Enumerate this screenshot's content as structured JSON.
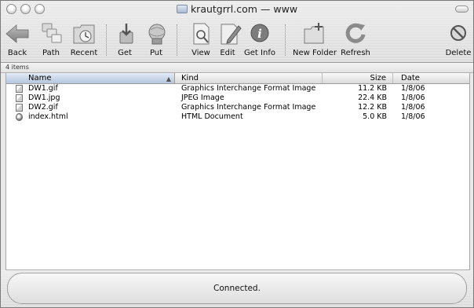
{
  "window": {
    "title": "krautgrrl.com — www"
  },
  "toolbar": {
    "items": [
      {
        "label": "Back",
        "icon": "back-arrow-icon"
      },
      {
        "label": "Path",
        "icon": "path-icon"
      },
      {
        "label": "Recent",
        "icon": "recent-icon"
      },
      {
        "label": "Get",
        "icon": "get-icon"
      },
      {
        "label": "Put",
        "icon": "put-icon"
      },
      {
        "label": "View",
        "icon": "view-icon"
      },
      {
        "label": "Edit",
        "icon": "edit-icon"
      },
      {
        "label": "Get Info",
        "icon": "info-icon"
      },
      {
        "label": "New Folder",
        "icon": "new-folder-icon"
      },
      {
        "label": "Refresh",
        "icon": "refresh-icon"
      },
      {
        "label": "Delete",
        "icon": "delete-icon"
      }
    ]
  },
  "status": {
    "item_count": "4 items",
    "message": "Connected."
  },
  "list": {
    "columns": {
      "name": "Name",
      "kind": "Kind",
      "size": "Size",
      "date": "Date"
    },
    "rows": [
      {
        "name": "DW1.gif",
        "kind": "Graphics Interchange Format Image",
        "size": "11.2 KB",
        "date": "1/8/06",
        "icon": "image-file-icon"
      },
      {
        "name": "DW1.jpg",
        "kind": "JPEG Image",
        "size": "22.4 KB",
        "date": "1/8/06",
        "icon": "image-file-icon"
      },
      {
        "name": "DW2.gif",
        "kind": "Graphics Interchange Format Image",
        "size": "12.2 KB",
        "date": "1/8/06",
        "icon": "image-file-icon"
      },
      {
        "name": "index.html",
        "kind": "HTML Document",
        "size": "5.0 KB",
        "date": "1/8/06",
        "icon": "html-file-icon"
      }
    ]
  }
}
